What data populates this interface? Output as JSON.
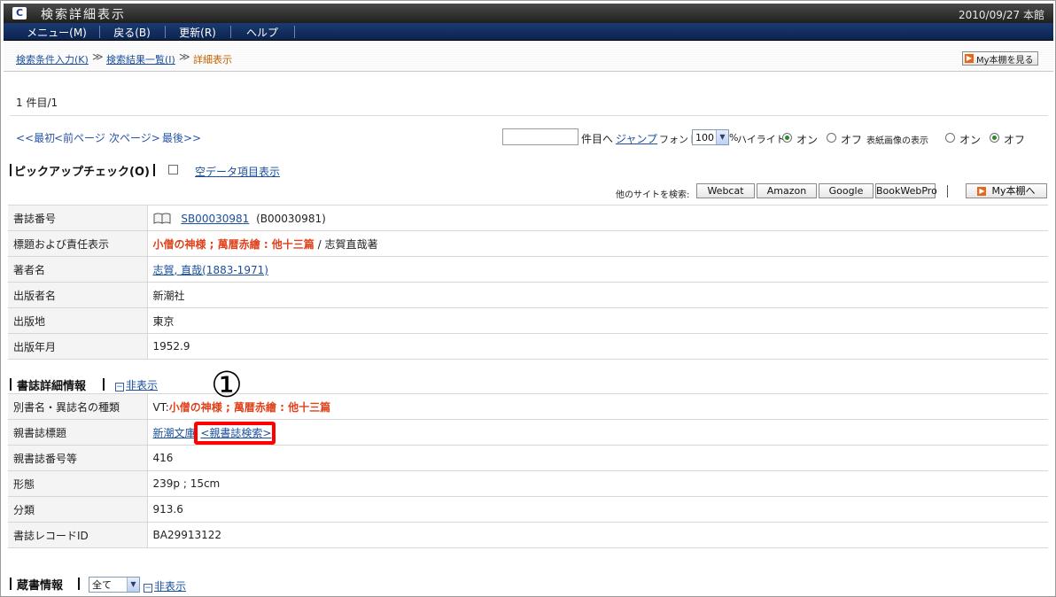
{
  "window": {
    "title": "検索詳細表示",
    "date_location": "2010/09/27 本館",
    "logo_letter": "C"
  },
  "menu": [
    {
      "label": "メニュー(M)"
    },
    {
      "label": "戻る(B)"
    },
    {
      "label": "更新(R)"
    },
    {
      "label": "ヘルプ"
    }
  ],
  "breadcrumb": {
    "item1": "検索条件入力(K)",
    "item2": "検索結果一覧(I)",
    "current": "詳細表示",
    "sep": "≫",
    "mybook_label": "My本棚を見る"
  },
  "result": {
    "count": "1 件目/1"
  },
  "pager": {
    "first": "<<最初",
    "prev": "<前ページ",
    "next": "次ページ>",
    "last": "最後>>"
  },
  "jump": {
    "value": "",
    "suffix": "件目へ",
    "button": "ジャンプ"
  },
  "font": {
    "label": "フォント",
    "value": "100",
    "unit": "%"
  },
  "highlight": {
    "label": "ハイライト",
    "on": "オン",
    "off": "オフ",
    "selected": "on"
  },
  "cover": {
    "label": "表紙画像の表示",
    "on": "オン",
    "off": "オフ",
    "selected": "off"
  },
  "pickup": {
    "title": "ピックアップチェック(O)",
    "empty_fields": "空データ項目表示"
  },
  "external": {
    "label": "他のサイトを検索:",
    "buttons": [
      "Webcat",
      "Amazon",
      "Google",
      "BookWebPro"
    ],
    "mybook_add": "My本棚へ"
  },
  "biblio": [
    {
      "key": "書誌番号",
      "id_link": "SB00030981",
      "id_extra": "(B00030981)"
    },
    {
      "key": "標題および責任表示",
      "title_red": "小僧の神様 ; 萬暦赤繪 : 他十三篇",
      "resp": " / 志賀直哉著"
    },
    {
      "key": "著者名",
      "author_link": "志賀, 直哉(1883-1971)"
    },
    {
      "key": "出版者名",
      "value": "新潮社"
    },
    {
      "key": "出版地",
      "value": "東京"
    },
    {
      "key": "出版年月",
      "value": "1952.9"
    }
  ],
  "detail_section": {
    "title": "書誌詳細情報",
    "hide": "非表示"
  },
  "detail": [
    {
      "key": "別書名・異誌名の種類",
      "prefix": "VT:",
      "value_red": "小僧の神様 ; 萬暦赤繪 : 他十三篇"
    },
    {
      "key": "親書誌標題",
      "series_link": "新潮文庫",
      "parent_search": "<親書誌検索>"
    },
    {
      "key": "親書誌番号等",
      "value": "416"
    },
    {
      "key": "形態",
      "value": "239p ; 15cm"
    },
    {
      "key": "分類",
      "value": "913.6"
    },
    {
      "key": "書誌レコードID",
      "value": "BA29913122"
    }
  ],
  "holdings": {
    "title": "蔵書情報",
    "filter": "全て",
    "hide": "非表示"
  },
  "annotation": {
    "number": "①",
    "color": "#ff0000"
  }
}
